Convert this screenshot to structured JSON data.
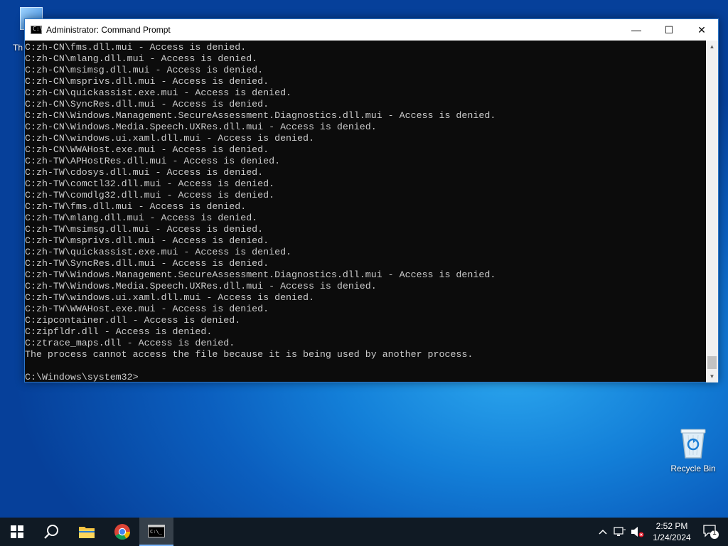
{
  "desktop": {
    "partial_icon_label": "Th",
    "recycle_bin_label": "Recycle Bin"
  },
  "window": {
    "title": "Administrator: Command Prompt",
    "minimize_glyph": "—",
    "maximize_glyph": "☐",
    "close_glyph": "✕"
  },
  "console_lines": [
    "C:zh-CN\\fms.dll.mui - Access is denied.",
    "C:zh-CN\\mlang.dll.mui - Access is denied.",
    "C:zh-CN\\msimsg.dll.mui - Access is denied.",
    "C:zh-CN\\msprivs.dll.mui - Access is denied.",
    "C:zh-CN\\quickassist.exe.mui - Access is denied.",
    "C:zh-CN\\SyncRes.dll.mui - Access is denied.",
    "C:zh-CN\\Windows.Management.SecureAssessment.Diagnostics.dll.mui - Access is denied.",
    "C:zh-CN\\Windows.Media.Speech.UXRes.dll.mui - Access is denied.",
    "C:zh-CN\\windows.ui.xaml.dll.mui - Access is denied.",
    "C:zh-CN\\WWAHost.exe.mui - Access is denied.",
    "C:zh-TW\\APHostRes.dll.mui - Access is denied.",
    "C:zh-TW\\cdosys.dll.mui - Access is denied.",
    "C:zh-TW\\comctl32.dll.mui - Access is denied.",
    "C:zh-TW\\comdlg32.dll.mui - Access is denied.",
    "C:zh-TW\\fms.dll.mui - Access is denied.",
    "C:zh-TW\\mlang.dll.mui - Access is denied.",
    "C:zh-TW\\msimsg.dll.mui - Access is denied.",
    "C:zh-TW\\msprivs.dll.mui - Access is denied.",
    "C:zh-TW\\quickassist.exe.mui - Access is denied.",
    "C:zh-TW\\SyncRes.dll.mui - Access is denied.",
    "C:zh-TW\\Windows.Management.SecureAssessment.Diagnostics.dll.mui - Access is denied.",
    "C:zh-TW\\Windows.Media.Speech.UXRes.dll.mui - Access is denied.",
    "C:zh-TW\\windows.ui.xaml.dll.mui - Access is denied.",
    "C:zh-TW\\WWAHost.exe.mui - Access is denied.",
    "C:zipcontainer.dll - Access is denied.",
    "C:zipfldr.dll - Access is denied.",
    "C:ztrace_maps.dll - Access is denied.",
    "The process cannot access the file because it is being used by another process.",
    "",
    "C:\\Windows\\system32>"
  ],
  "taskbar": {
    "items": [
      "start-button",
      "search-button",
      "file-explorer",
      "google-chrome",
      "command-prompt"
    ],
    "active_item": "command-prompt",
    "time": "2:52 PM",
    "date": "1/24/2024",
    "notification_count": "1",
    "tray_icons": [
      "chevron-up-icon",
      "network-icon",
      "volume-muted-icon"
    ]
  },
  "colors": {
    "console_bg": "#0c0c0c",
    "console_text": "#cccccc",
    "taskbar_bg": "#101a24",
    "accent": "#2c77c9"
  }
}
